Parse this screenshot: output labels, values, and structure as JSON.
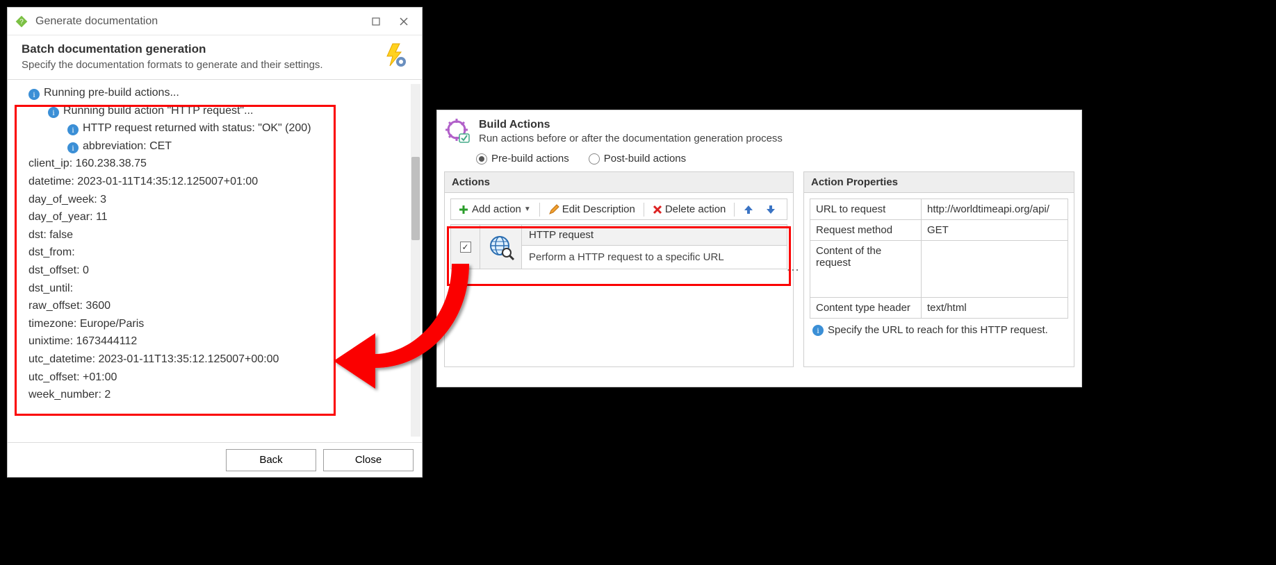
{
  "dialog": {
    "title": "Generate documentation",
    "header_title": "Batch documentation generation",
    "header_subtitle": "Specify the documentation formats to generate and their settings.",
    "log": {
      "line0": "Running pre-build actions...",
      "line1": "Running build action \"HTTP request\"...",
      "line2": "HTTP request returned with status: \"OK\" (200)",
      "line3": "abbreviation: CET",
      "plain": [
        "client_ip: 160.238.38.75",
        "datetime: 2023-01-11T14:35:12.125007+01:00",
        "day_of_week: 3",
        "day_of_year: 11",
        "dst: false",
        "dst_from:",
        "dst_offset: 0",
        "dst_until:",
        "raw_offset: 3600",
        "timezone: Europe/Paris",
        "unixtime: 1673444112",
        "utc_datetime: 2023-01-11T13:35:12.125007+00:00",
        "utc_offset: +01:00",
        "week_number: 2"
      ]
    },
    "back_label": "Back",
    "close_label": "Close"
  },
  "panel": {
    "header_title": "Build Actions",
    "header_subtitle": "Run actions before or after the documentation generation process",
    "radio_pre": "Pre-build actions",
    "radio_post": "Post-build actions",
    "actions_hdr": "Actions",
    "props_hdr": "Action Properties",
    "toolbar": {
      "add": "Add action",
      "edit": "Edit Description",
      "del": "Delete action"
    },
    "action": {
      "title": "HTTP request",
      "desc": "Perform a HTTP request to a specific URL"
    },
    "props": {
      "url_k": "URL to request",
      "url_v": "http://worldtimeapi.org/api/",
      "method_k": "Request method",
      "method_v": "GET",
      "content_k": "Content of the request",
      "content_v": "",
      "ctype_k": "Content type header",
      "ctype_v": "text/html"
    },
    "help": "Specify the URL to reach for this HTTP request."
  }
}
